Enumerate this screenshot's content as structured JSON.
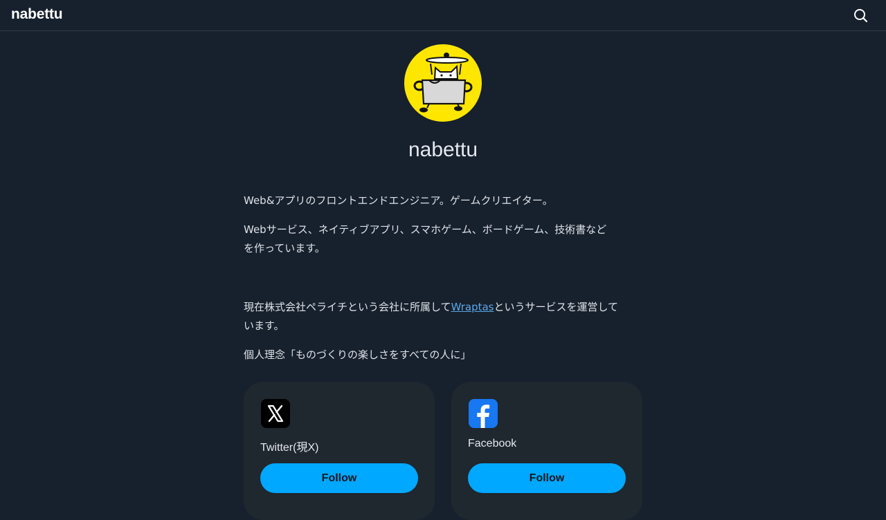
{
  "header": {
    "brand": "nabettu",
    "search_icon": "search-icon"
  },
  "profile": {
    "avatar_icon": "cat-pot-avatar",
    "avatar_bg": "#ffe600",
    "name": "nabettu"
  },
  "bio": {
    "line1": "Web&アプリのフロントエンドエンジニア。ゲームクリエイター。",
    "line2": "Webサービス、ネイティブアプリ、スマホゲーム、ボードゲーム、技術書など",
    "line3": "を作っています。",
    "line4_before": "現在株式会社ペライチという会社に所属して",
    "line4_link": "Wraptas",
    "line4_after": "というサービスを運営して",
    "line5": "います。",
    "line6": "個人理念「ものづくりの楽しさをすべての人に」"
  },
  "social": [
    {
      "icon": "x-icon",
      "label": "Twitter(現X)",
      "button": "Follow"
    },
    {
      "icon": "facebook-icon",
      "label": "Facebook",
      "button": "Follow"
    }
  ],
  "colors": {
    "background": "#17202d",
    "card": "#1f272f",
    "accent": "#00a8ff",
    "link": "#5aa9e8"
  }
}
